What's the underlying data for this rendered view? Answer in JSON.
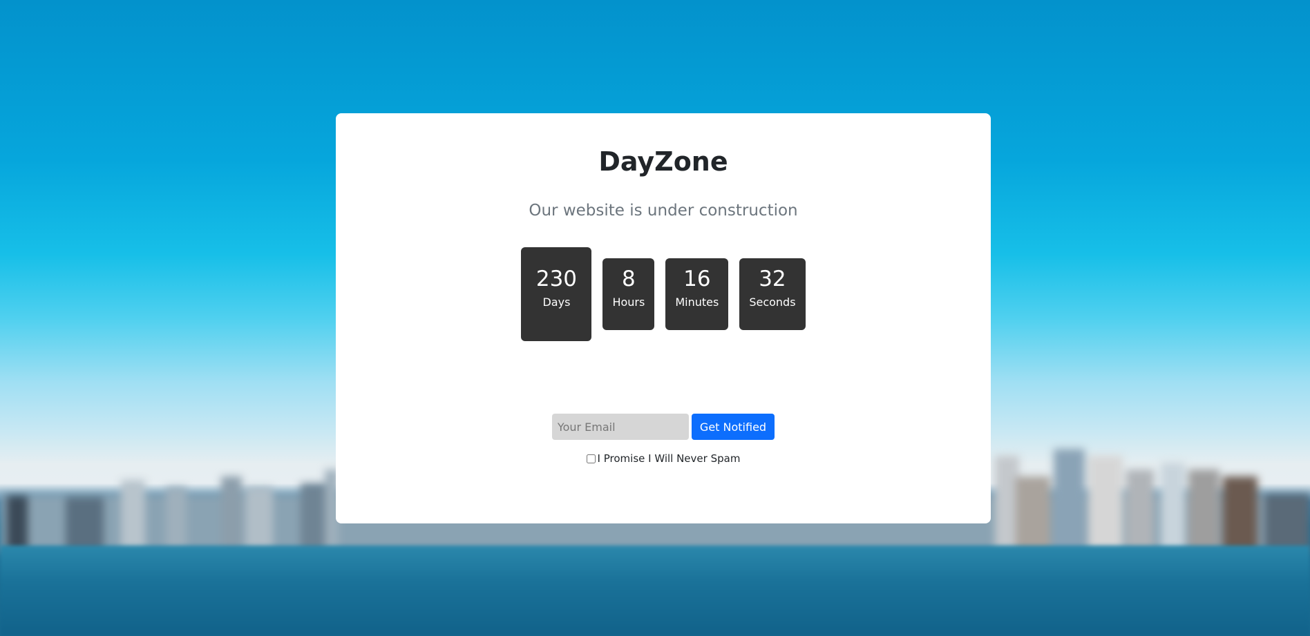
{
  "site": {
    "title": "DayZone",
    "subtitle": "Our website is under construction"
  },
  "countdown": {
    "days": {
      "value": "230",
      "label": "Days"
    },
    "hours": {
      "value": "8",
      "label": "Hours"
    },
    "minutes": {
      "value": "16",
      "label": "Minutes"
    },
    "seconds": {
      "value": "32",
      "label": "Seconds"
    }
  },
  "signup": {
    "email_placeholder": "Your Email",
    "button_label": "Get Notified",
    "checkbox_label": "I Promise I Will Never Spam",
    "checkbox_checked": false
  },
  "colors": {
    "accent": "#0d6efd",
    "countdown_box": "#333333",
    "card": "#ffffff"
  }
}
